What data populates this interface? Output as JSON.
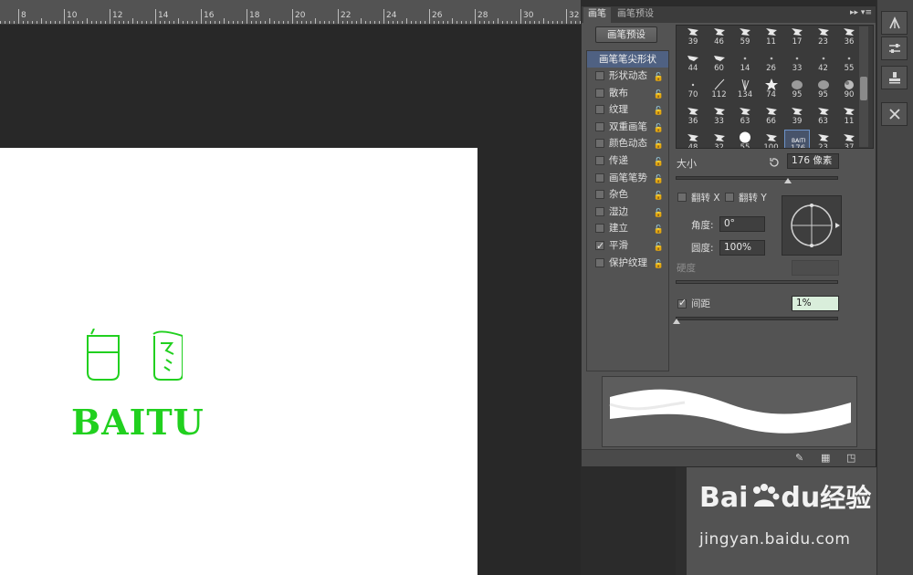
{
  "ruler": {
    "labels": [
      "8",
      "10",
      "12",
      "14",
      "16",
      "18",
      "20",
      "22",
      "24",
      "26",
      "28",
      "30",
      "32"
    ]
  },
  "logo": {
    "chinese": "白图",
    "text": "BAITU",
    "color": "#21d01f"
  },
  "panel": {
    "tabs": [
      "画笔",
      "画笔预设"
    ],
    "menu_icon": "▸▸ ▾≡",
    "preset_button": "画笔预设",
    "tip_shape_header": "画笔笔尖形状",
    "options": [
      {
        "label": "形状动态",
        "checked": false
      },
      {
        "label": "散布",
        "checked": false
      },
      {
        "label": "纹理",
        "checked": false
      },
      {
        "label": "双重画笔",
        "checked": false
      },
      {
        "label": "颜色动态",
        "checked": false
      },
      {
        "label": "传递",
        "checked": false
      },
      {
        "label": "画笔笔势",
        "checked": false
      },
      {
        "label": "杂色",
        "checked": false
      },
      {
        "label": "湿边",
        "checked": false
      },
      {
        "label": "建立",
        "checked": false
      },
      {
        "label": "平滑",
        "checked": true
      },
      {
        "label": "保护纹理",
        "checked": false
      }
    ],
    "brush_rows": [
      [
        "39",
        "46",
        "59",
        "11",
        "17",
        "23",
        "36"
      ],
      [
        "44",
        "60",
        "14",
        "26",
        "33",
        "42",
        "55"
      ],
      [
        "70",
        "112",
        "134",
        "74",
        "95",
        "95",
        "90"
      ],
      [
        "36",
        "33",
        "63",
        "66",
        "39",
        "63",
        "11"
      ],
      [
        "48",
        "32",
        "55",
        "100",
        "176",
        "23",
        "37"
      ]
    ],
    "selected_brush": "176",
    "size_label": "大小",
    "size_value": "176 像素",
    "flip_x_label": "翻转 X",
    "flip_y_label": "翻转 Y",
    "angle_label": "角度:",
    "angle_value": "0°",
    "roundness_label": "圆度:",
    "roundness_value": "100%",
    "hardness_label": "硬度",
    "spacing_label": "间距",
    "spacing_value": "1%",
    "spacing_checked": true
  },
  "watermark": {
    "brand": "Bai",
    "brand2": "du",
    "cn": "经验",
    "url": "jingyan.baidu.com"
  }
}
